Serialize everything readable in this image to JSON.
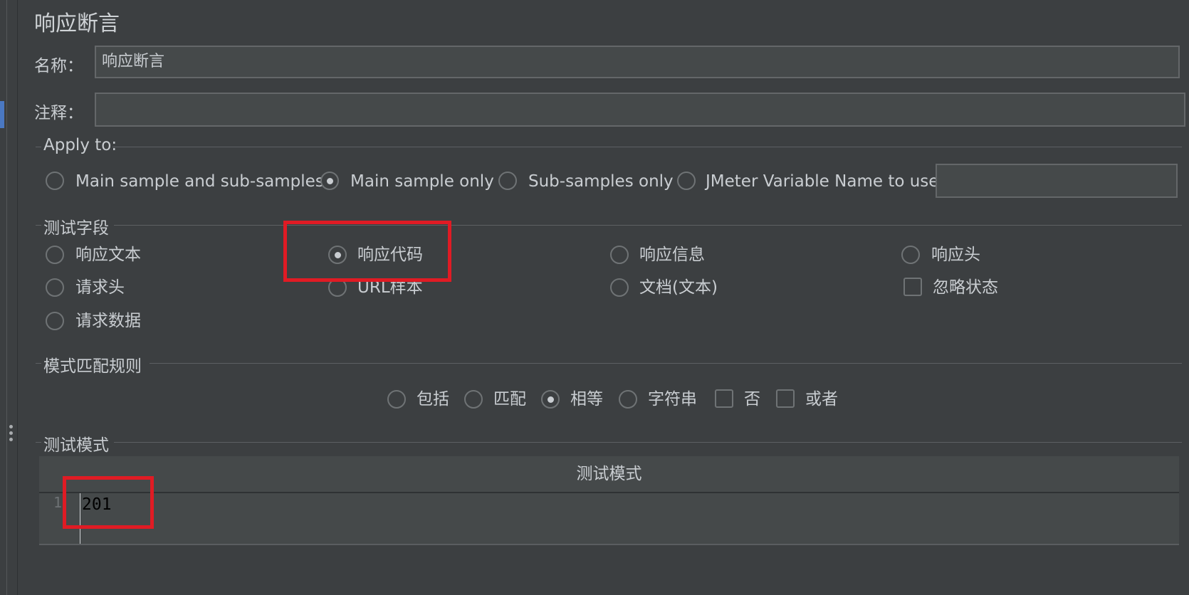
{
  "window": {
    "title": "响应断言"
  },
  "name_field": {
    "label": "名称：",
    "value": "响应断言"
  },
  "comment_field": {
    "label": "注释：",
    "value": ""
  },
  "apply_to": {
    "title": "Apply to:",
    "options": [
      {
        "label": "Main sample and sub-samples",
        "checked": false
      },
      {
        "label": "Main sample only",
        "checked": true
      },
      {
        "label": "Sub-samples only",
        "checked": false
      },
      {
        "label": "JMeter Variable Name to use",
        "checked": false
      }
    ],
    "variable_value": ""
  },
  "test_field": {
    "title": "测试字段",
    "options": [
      {
        "label": "响应文本",
        "checked": false
      },
      {
        "label": "响应代码",
        "checked": true
      },
      {
        "label": "响应信息",
        "checked": false
      },
      {
        "label": "响应头",
        "checked": false
      },
      {
        "label": "请求头",
        "checked": false
      },
      {
        "label": "URL样本",
        "checked": false
      },
      {
        "label": "文档(文本)",
        "checked": false
      },
      {
        "label": "忽略状态",
        "checked": false,
        "type": "checkbox"
      },
      {
        "label": "请求数据",
        "checked": false
      }
    ]
  },
  "pattern_rules": {
    "title": "模式匹配规则",
    "options": [
      {
        "label": "包括",
        "checked": false,
        "type": "radio"
      },
      {
        "label": "匹配",
        "checked": false,
        "type": "radio"
      },
      {
        "label": "相等",
        "checked": true,
        "type": "radio"
      },
      {
        "label": "字符串",
        "checked": false,
        "type": "radio"
      },
      {
        "label": "否",
        "checked": false,
        "type": "checkbox"
      },
      {
        "label": "或者",
        "checked": false,
        "type": "checkbox"
      }
    ]
  },
  "test_patterns": {
    "title": "测试模式",
    "column_header": "测试模式",
    "rows": [
      {
        "line": "1",
        "value": "201"
      }
    ]
  },
  "colors": {
    "background": "#3c3f41",
    "highlight": "#e01b24",
    "accent": "#4a78c2"
  }
}
